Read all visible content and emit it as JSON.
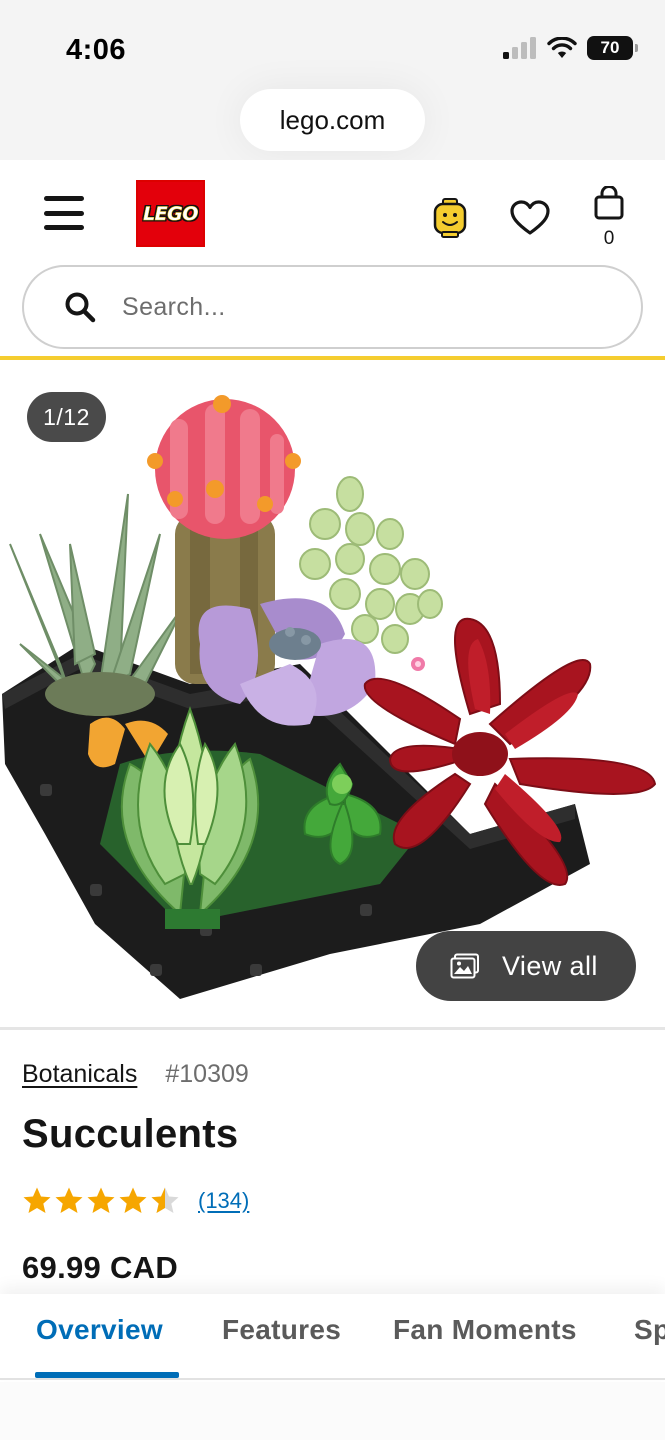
{
  "status_bar": {
    "time": "4:06",
    "battery": "70"
  },
  "browser": {
    "url": "lego.com"
  },
  "header": {
    "logo_text": "LEGO",
    "bag_count": "0",
    "search_placeholder": "Search..."
  },
  "gallery": {
    "counter": "1/12",
    "view_all_label": "View all"
  },
  "product": {
    "theme": "Botanicals",
    "item_number": "#10309",
    "title": "Succulents",
    "rating": 4.5,
    "review_count": "(134)",
    "price": "69.99 CAD"
  },
  "tabs": [
    {
      "label": "Overview",
      "active": true
    },
    {
      "label": "Features",
      "active": false
    },
    {
      "label": "Fan Moments",
      "active": false
    },
    {
      "label": "Sp",
      "active": false
    }
  ],
  "colors": {
    "accent_blue": "#006db7",
    "lego_red": "#e3000b",
    "header_rule_yellow": "#f5cd2f",
    "star_orange": "#f6a600"
  }
}
